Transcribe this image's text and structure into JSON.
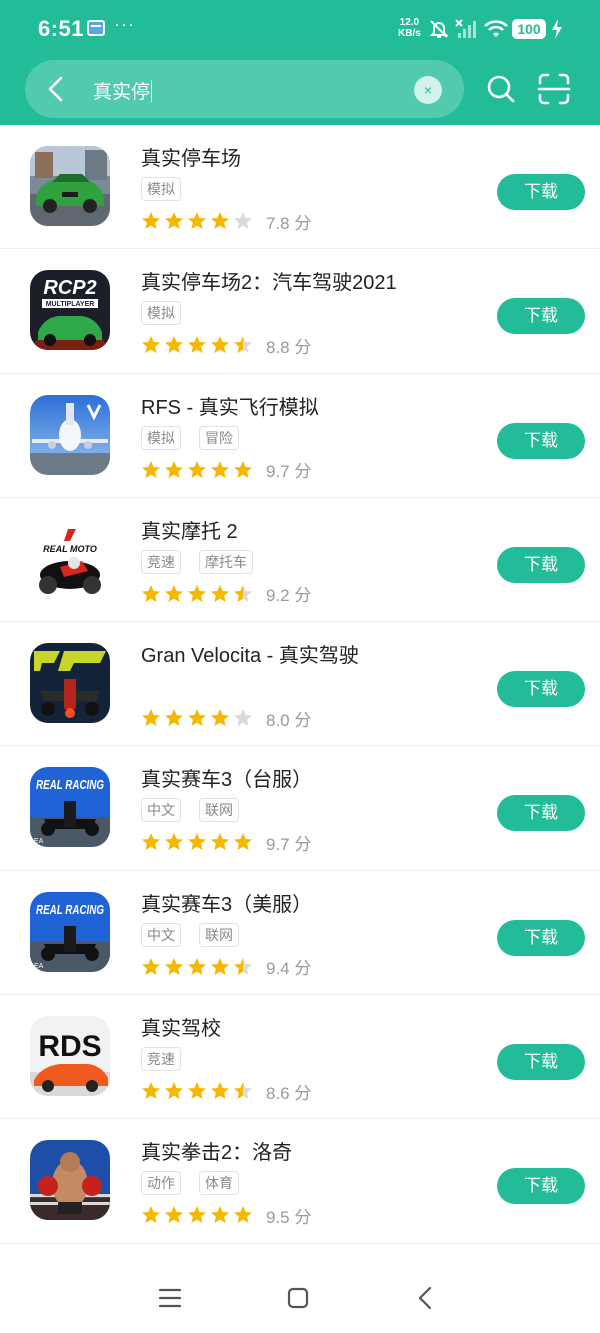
{
  "status": {
    "time": "6:51",
    "more": "···",
    "speed_value": "12.0",
    "speed_unit": "KB/s",
    "battery": "100"
  },
  "search": {
    "query": "真实停",
    "clear_symbol": "×"
  },
  "colors": {
    "accent": "#22BC98",
    "star": "#F5B800",
    "star_empty": "#DADADA"
  },
  "download_label": "下载",
  "score_unit": "分",
  "apps": [
    {
      "name": "真实停车场",
      "tags": [
        "模拟"
      ],
      "rating": 4,
      "score": "7.8",
      "icon": "green-sports-car-parking-icon"
    },
    {
      "name": "真实停车场2：汽车驾驶2021",
      "tags": [
        "模拟"
      ],
      "rating": 4.5,
      "score": "8.8",
      "icon": "rcp2-multiplayer-car-icon",
      "icon_text": "RCP2",
      "icon_subtext": "MULTIPLAYER"
    },
    {
      "name": "RFS - 真实飞行模拟",
      "tags": [
        "模拟",
        "冒险"
      ],
      "rating": 5,
      "score": "9.7",
      "icon": "airplane-icon"
    },
    {
      "name": "真实摩托 2",
      "tags": [
        "竞速",
        "摩托车"
      ],
      "rating": 4.5,
      "score": "9.2",
      "icon": "motorcycle-icon",
      "icon_text": "REAL MOTO"
    },
    {
      "name": "Gran Velocita - 真实驾驶",
      "tags": [],
      "rating": 4,
      "score": "8.0",
      "icon": "formula-car-icon"
    },
    {
      "name": "真实赛车3（台服）",
      "tags": [
        "中文",
        "联网"
      ],
      "rating": 5,
      "score": "9.7",
      "icon": "real-racing-icon",
      "icon_text": "REAL RACING",
      "icon_corner": "EA"
    },
    {
      "name": "真实赛车3（美服）",
      "tags": [
        "中文",
        "联网"
      ],
      "rating": 4.5,
      "score": "9.4",
      "icon": "real-racing-icon",
      "icon_text": "REAL RACING",
      "icon_corner": "EA"
    },
    {
      "name": "真实驾校",
      "tags": [
        "竞速"
      ],
      "rating": 4.5,
      "score": "8.6",
      "icon": "rds-orange-car-icon",
      "icon_text": "RDS"
    },
    {
      "name": "真实拳击2：洛奇",
      "tags": [
        "动作",
        "体育"
      ],
      "rating": 5,
      "score": "9.5",
      "icon": "boxer-icon"
    }
  ]
}
